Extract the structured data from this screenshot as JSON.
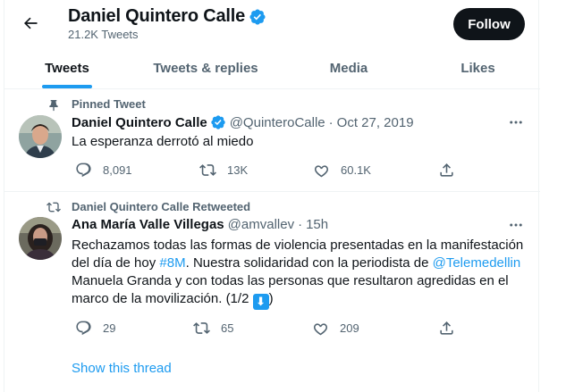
{
  "header": {
    "title": "Daniel Quintero Calle",
    "subtitle": "21.2K Tweets",
    "follow_label": "Follow"
  },
  "tabs": [
    {
      "label": "Tweets",
      "active": true
    },
    {
      "label": "Tweets & replies",
      "active": false
    },
    {
      "label": "Media",
      "active": false
    },
    {
      "label": "Likes",
      "active": false
    }
  ],
  "tweets": [
    {
      "context": "Pinned Tweet",
      "context_icon": "pin-icon",
      "name": "Daniel Quintero Calle",
      "verified": true,
      "handle": "@QuinteroCalle",
      "separator": "·",
      "time": "Oct 27, 2019",
      "text": "La esperanza derrotó al miedo",
      "counts": {
        "reply": "8,091",
        "retweet": "13K",
        "like": "60.1K"
      }
    },
    {
      "context": "Daniel Quintero Calle Retweeted",
      "context_icon": "retweet-icon",
      "name": "Ana María Valle Villegas",
      "verified": false,
      "handle": "@amvallev",
      "separator": "·",
      "time": "15h",
      "text_parts": {
        "p1": "Rechazamos todas las formas de violencia presentadas en la manifestación del día de hoy ",
        "hashtag": "#8M",
        "p2": ". Nuestra solidaridad con la periodista de ",
        "mention": "@Telemedellin",
        "p3": " Manuela Granda y con todas las personas que resultaron agredidas en el marco de la movilización. (1/2 ",
        "emoji": "⬇",
        "p4": ")"
      },
      "counts": {
        "reply": "29",
        "retweet": "65",
        "like": "209"
      },
      "show_thread": "Show this thread"
    }
  ],
  "colors": {
    "accent": "#1d9bf0",
    "text": "#0f1419",
    "secondary": "#536471",
    "border": "#eff3f4"
  }
}
